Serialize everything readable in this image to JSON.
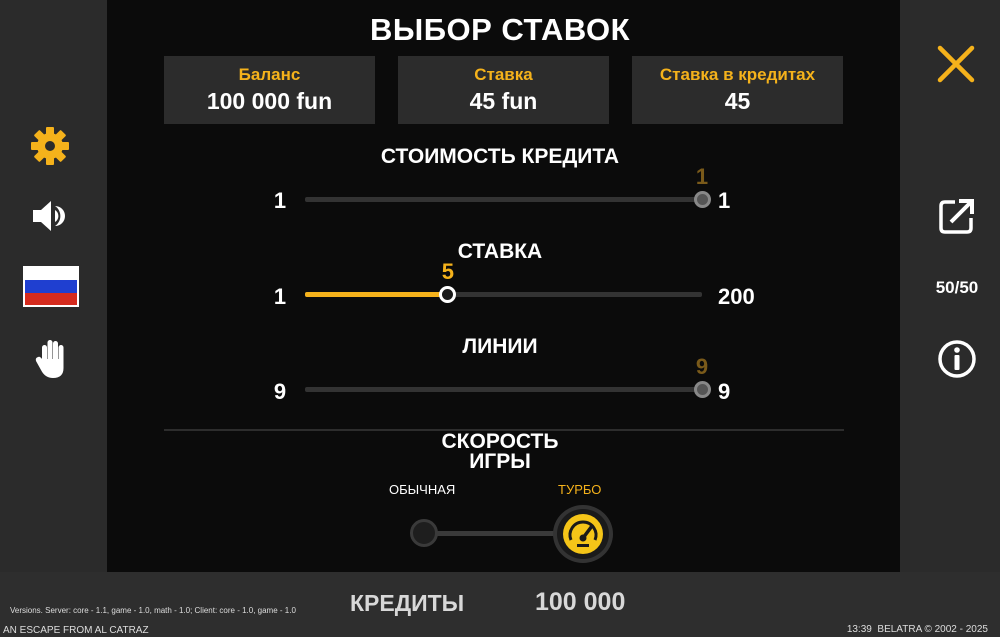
{
  "title": "ВЫБОР СТАВОК",
  "info": [
    {
      "label": "Баланс",
      "value": "100 000 fun"
    },
    {
      "label": "Ставка",
      "value": "45 fun"
    },
    {
      "label": "Ставка в кредитах",
      "value": "45"
    }
  ],
  "credit_cost": {
    "title": "СТОИМОСТЬ КРЕДИТА",
    "min": "1",
    "max": "1",
    "value": "1",
    "fraction": 1.0
  },
  "bet": {
    "title": "СТАВКА",
    "min": "1",
    "max": "200",
    "value": "5",
    "fraction": 0.36
  },
  "lines": {
    "title": "ЛИНИИ",
    "min": "9",
    "max": "9",
    "value": "9",
    "fraction": 1.0
  },
  "speed": {
    "title_line1": "СКОРОСТЬ",
    "title_line2": "ИГРЫ",
    "normal_label": "ОБЫЧНАЯ",
    "turbo_label": "ТУРБО",
    "selected": "turbo"
  },
  "left_icons": [
    "gear-icon",
    "sound-icon",
    "russian-flag-icon",
    "hand-icon"
  ],
  "right_icons": [
    "close-icon",
    "share-icon",
    "fifty-fifty-icon",
    "info-icon"
  ],
  "fifty_label": "50/50",
  "bottom": {
    "credits_label": "КРЕДИТЫ",
    "credits_value": "100 000",
    "versions": "Versions. Server: core - 1.1, game - 1.0, math - 1.0; Client: core - 1.0, game - 1.0",
    "game_name": "AN ESCAPE FROM AL CATRAZ",
    "time": "13:39",
    "copyright": "BELATRA © 2002 - 2025"
  },
  "colors": {
    "accent": "#f5b21b",
    "panel": "#2c2c2c",
    "background": "#0b0b0b"
  }
}
